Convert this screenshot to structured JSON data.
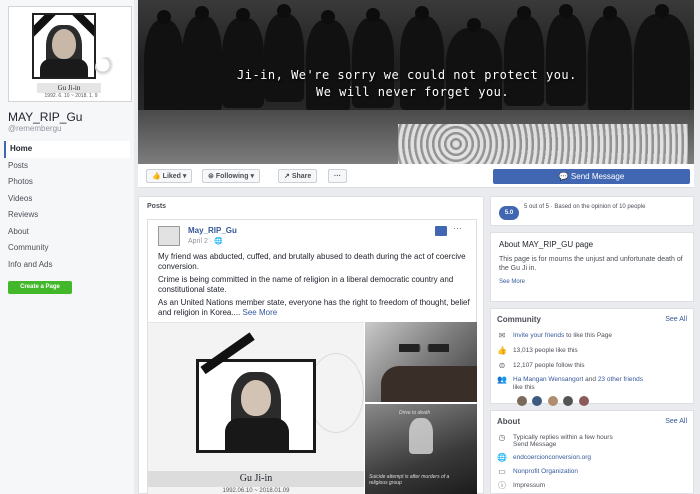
{
  "profile": {
    "pic_name": "Gu Ji-in",
    "pic_dates": "1992. 6. 10 ~ 2018. 1. 9",
    "page_name": "MAY_RIP_Gu",
    "handle": "@remembergu"
  },
  "nav": {
    "items": [
      {
        "label": "Home"
      },
      {
        "label": "Posts"
      },
      {
        "label": "Photos"
      },
      {
        "label": "Videos"
      },
      {
        "label": "Reviews"
      },
      {
        "label": "About"
      },
      {
        "label": "Community"
      },
      {
        "label": "Info and Ads"
      }
    ],
    "create_label": "Create a Page"
  },
  "cover": {
    "line1": "Ji-in, We're sorry we could not protect you.",
    "line2": "We will never forget you."
  },
  "actions": {
    "liked": "Liked",
    "following": "Following",
    "share": "Share",
    "more": "···",
    "send_message": "Send Message"
  },
  "posts": {
    "title": "Posts",
    "author": "May_RIP_Gu",
    "date": "April 2 · ",
    "more": "···",
    "paragraphs": [
      "My friend was abducted, cuffed, and brutally abused to death during the act of coercive conversion.",
      "Crime is being committed in the name of religion in a liberal democratic country and constitutional state.",
      "As an United Nations member state, everyone has the right to freedom of thought, belief and religion in Korea...."
    ],
    "see_more": "See More",
    "image_name": "Gu Ji-in",
    "image_dates": "1992.06.10 ~ 2018.01.09",
    "side_caption1": "Drive to death",
    "side_caption2": "Suicide attempt is after murders of a religious group"
  },
  "rating": {
    "score": "5.0",
    "text": "5 out of 5 · Based on the opinion of 10 people"
  },
  "about_page": {
    "heading": "About MAY_RIP_GU page",
    "text": "This page is for mourns the unjust and unfortunate death of the Gu Ji in.",
    "link": "See More"
  },
  "community": {
    "title": "Community",
    "see_all": "See All",
    "invite_link": "Invite your friends",
    "invite_rest": " to like this Page",
    "likes": "13,013 people like this",
    "follows": "12,107 people follow this",
    "friends_link": "Ha Mangan Wensangort",
    "friends_mid": " and ",
    "friends_more": "23 other friends",
    "friends_tail": "like this"
  },
  "about": {
    "title": "About",
    "see_all": "See All",
    "replies": "Typically replies within a few hours",
    "send_message": "Send Message",
    "website": "endcoercionconversion.org",
    "category": "Nonprofit Organization",
    "impressum": "Impressum"
  },
  "colors": {
    "brand_blue": "#4267b2",
    "link_blue": "#365899",
    "green_button": "#42b72a"
  }
}
